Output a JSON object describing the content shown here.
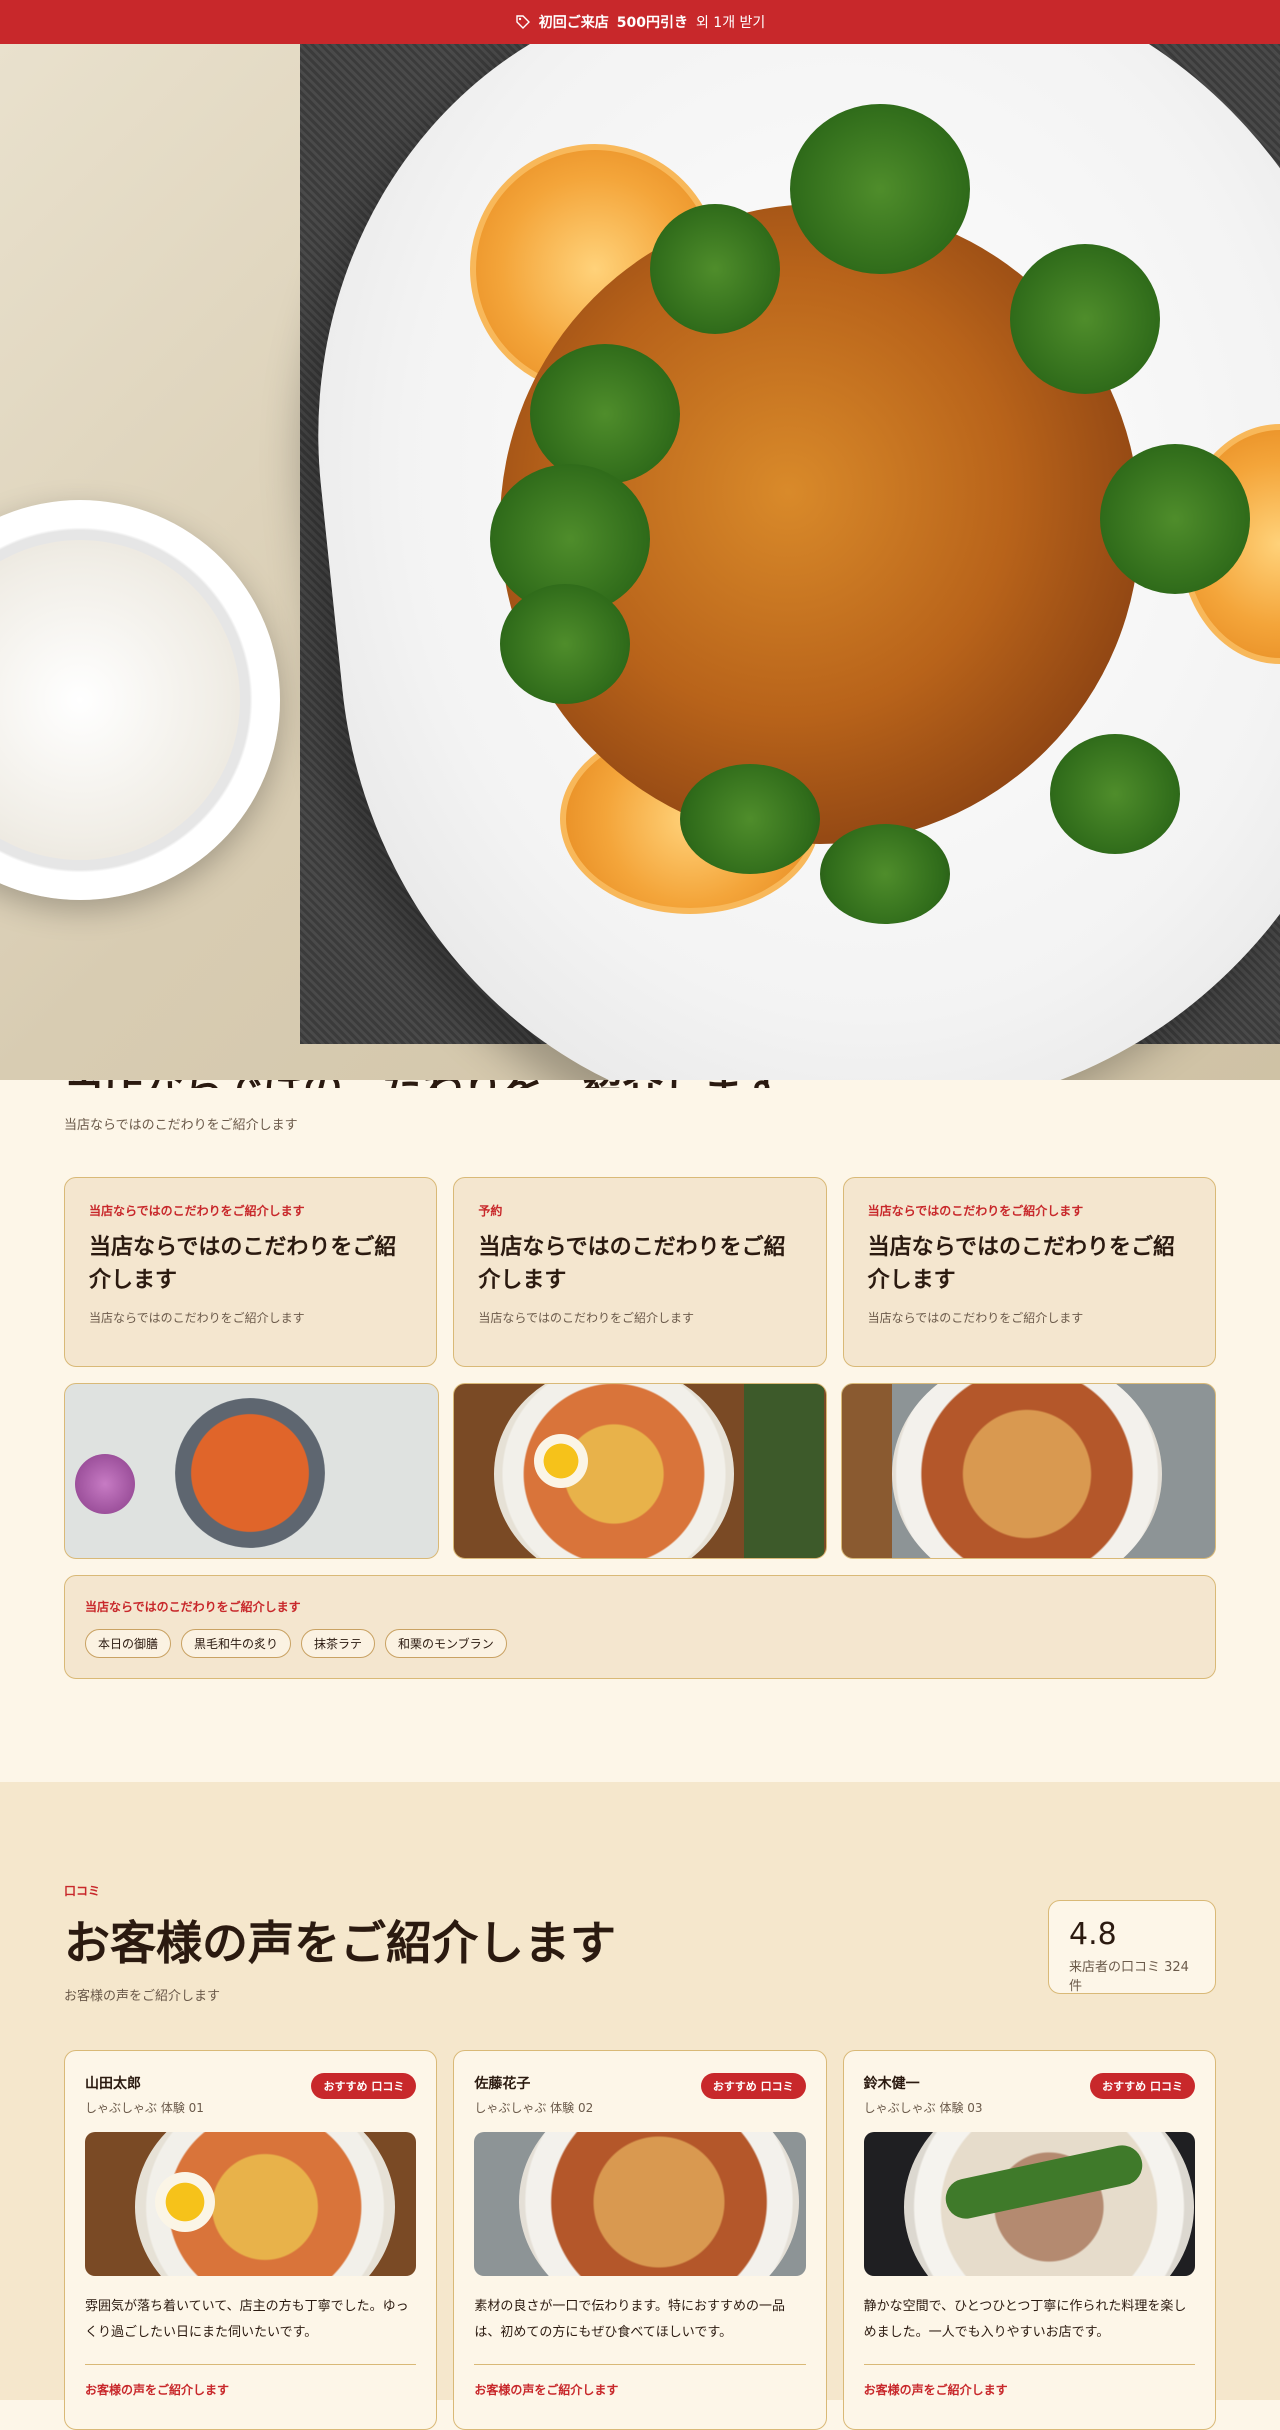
{
  "promo": {
    "strong": "初回ご来店",
    "amount": "500円引き",
    "rest": "외 1개 받기"
  },
  "intro": {
    "title": "当店ならではのこだわりをご紹介します",
    "subtitle": "当店ならではのこだわりをご紹介します"
  },
  "features": [
    {
      "eyebrow": "当店ならではのこだわりをご紹介します",
      "title": "当店ならではのこだわりをご紹介します",
      "desc": "当店ならではのこだわりをご紹介します"
    },
    {
      "eyebrow": "予約",
      "title": "当店ならではのこだわりをご紹介します",
      "desc": "当店ならではのこだわりをご紹介します"
    },
    {
      "eyebrow": "当店ならではのこだわりをご紹介します",
      "title": "当店ならではのこだわりをご紹介します",
      "desc": "当店ならではのこだわりをご紹介します"
    }
  ],
  "tags": {
    "eyebrow": "当店ならではのこだわりをご紹介します",
    "items": [
      "本日の御膳",
      "黒毛和牛の炙り",
      "抹茶ラテ",
      "和栗のモンブラン"
    ]
  },
  "reviews": {
    "eyebrow": "口コミ",
    "title": "お客様の声をご紹介します",
    "subtitle": "お客様の声をご紹介します",
    "rating": "4.8",
    "rating_count": "来店者の口コミ 324件",
    "items": [
      {
        "name": "山田太郎",
        "meta": "しゃぶしゃぶ 体験 01",
        "badge": "おすすめ 口コミ",
        "text": "雰囲気が落ち着いていて、店主の方も丁寧でした。ゆっくり過ごしたい日にまた伺いたいです。",
        "link": "お客様の声をご紹介します"
      },
      {
        "name": "佐藤花子",
        "meta": "しゃぶしゃぶ 体験 02",
        "badge": "おすすめ 口コミ",
        "text": "素材の良さが一口で伝わります。特におすすめの一品は、初めての方にもぜひ食べてほしいです。",
        "link": "お客様の声をご紹介します"
      },
      {
        "name": "鈴木健一",
        "meta": "しゃぶしゃぶ 体験 03",
        "badge": "おすすめ 口コミ",
        "text": "静かな空間で、ひとつひとつ丁寧に作られた料理を楽しめました。一人でも入りやすいお店です。",
        "link": "お客様の声をご紹介します"
      }
    ]
  }
}
